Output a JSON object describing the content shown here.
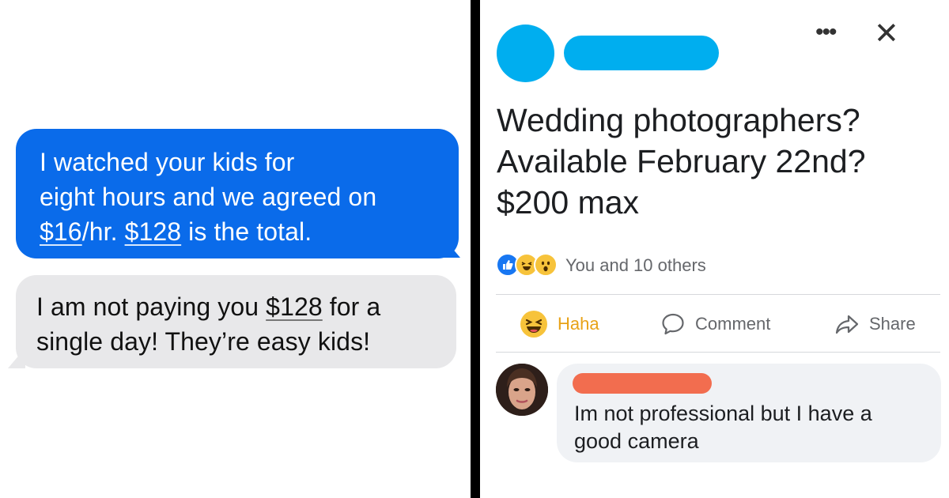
{
  "messages": {
    "sent": {
      "line1": "I watched your kids for",
      "line2": "eight hours and we agreed on",
      "line3_rate": "$16",
      "line3_unit": "/hr. ",
      "line3_total": "$128",
      "line3_rest": " is the total."
    },
    "received": {
      "line1_pre": "I am not paying you ",
      "line1_amount": "$128",
      "line1_post": " for a",
      "line2": "single day! They’re easy kids!"
    }
  },
  "post": {
    "line1": "Wedding photographers?",
    "line2": "Available February 22nd?",
    "line3": "$200 max",
    "more_icon": "•••",
    "close_icon": "✕",
    "reactions": {
      "icons": [
        "like-icon",
        "haha-icon",
        "wow-icon"
      ],
      "count_text": "You and 10 others"
    },
    "actions": {
      "haha_label": "Haha",
      "comment_label": "Comment",
      "share_label": "Share"
    },
    "comment": {
      "line1": "Im not professional but I have a",
      "line2": "good camera"
    }
  },
  "colors": {
    "imessage_blue": "#0a6bea",
    "imessage_gray": "#e8e8ea",
    "name_redaction_blue": "#00aeef",
    "name_redaction_orange": "#f26d4f",
    "haha_yellow": "#e8a217",
    "divider": "#000000"
  }
}
